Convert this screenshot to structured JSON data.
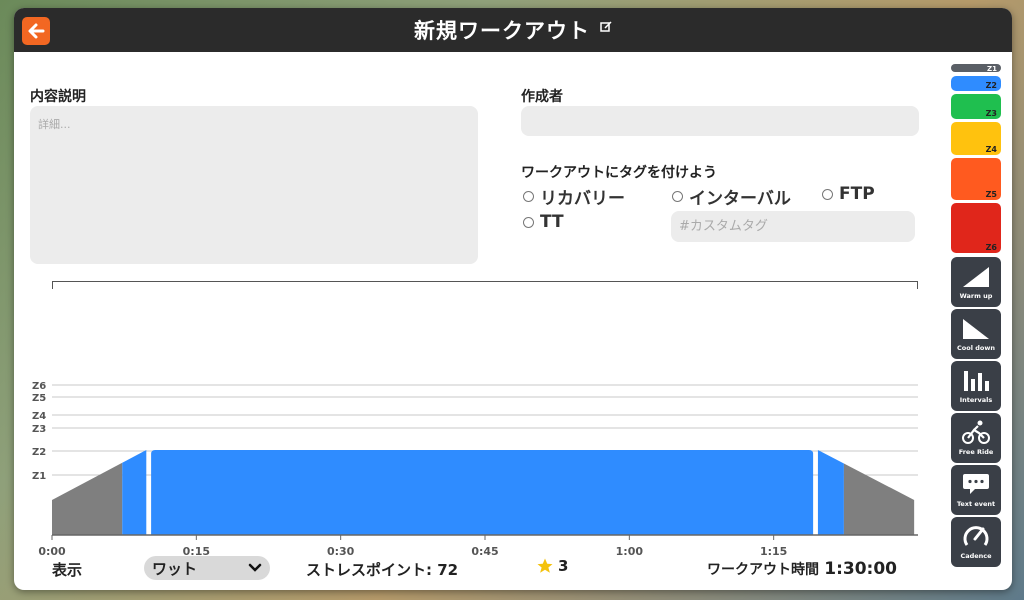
{
  "header": {
    "title": "新規ワークアウト"
  },
  "form": {
    "description_label": "内容説明",
    "description_placeholder": "詳細...",
    "author_label": "作成者",
    "author_value": "",
    "tags_label": "ワークアウトにタグを付けよう",
    "tags": [
      "リカバリー",
      "インターバル",
      "FTP",
      "TT"
    ],
    "custom_tag_placeholder": "#カスタムタグ"
  },
  "chart_data": {
    "type": "area",
    "zone_labels": [
      "Z6",
      "Z5",
      "Z4",
      "Z3",
      "Z2",
      "Z1"
    ],
    "x_ticks": [
      "0:00",
      "0:15",
      "0:30",
      "0:45",
      "1:00",
      "1:15"
    ],
    "x_tick_minutes": [
      0,
      15,
      30,
      45,
      60,
      75
    ],
    "x_range_minutes": [
      0,
      90
    ],
    "segments": [
      {
        "kind": "warmup",
        "start_min": 0,
        "end_min": 7.3,
        "color": "#7f7f7f"
      },
      {
        "kind": "warmup",
        "start_min": 7.3,
        "end_min": 9.8,
        "color": "#2f8cff"
      },
      {
        "kind": "steady",
        "start_min": 10.3,
        "end_min": 79.1,
        "color": "#2f8cff"
      },
      {
        "kind": "cooldown",
        "start_min": 79.6,
        "end_min": 82.3,
        "color": "#2f8cff"
      },
      {
        "kind": "cooldown",
        "start_min": 82.3,
        "end_min": 89.6,
        "color": "#7f7f7f"
      }
    ]
  },
  "footer": {
    "display_label": "表示",
    "display_value": "ワット",
    "stress_label": "ストレスポイント:",
    "stress_value": "72",
    "rating": "3",
    "duration_label": "ワークアウト時間",
    "duration_value": "1:30:00"
  },
  "sidebar": {
    "zones": [
      {
        "label": "Z1",
        "color": "#5a5f66"
      },
      {
        "label": "Z2",
        "color": "#2f8cff"
      },
      {
        "label": "Z3",
        "color": "#1fbf4f"
      },
      {
        "label": "Z4",
        "color": "#ffc20e"
      },
      {
        "label": "Z5",
        "color": "#ff5a1f"
      },
      {
        "label": "Z6",
        "color": "#e0261b"
      }
    ],
    "tools": [
      "Warm up",
      "Cool down",
      "Intervals",
      "Free Ride",
      "Text event",
      "Cadence"
    ]
  },
  "colors": {
    "accent": "#f26722",
    "header_bg": "#2b2b2b",
    "tool_bg": "#3a3f47"
  }
}
